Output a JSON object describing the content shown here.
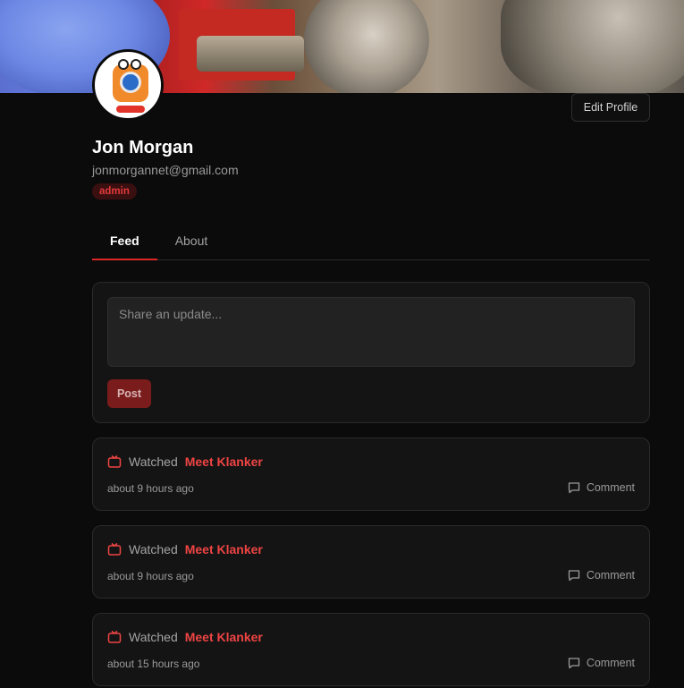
{
  "profile": {
    "name": "Jon Morgan",
    "email": "jonmorgannet@gmail.com",
    "role_badge": "admin",
    "edit_label": "Edit Profile"
  },
  "tabs": [
    {
      "label": "Feed",
      "active": true
    },
    {
      "label": "About",
      "active": false
    }
  ],
  "composer": {
    "placeholder": "Share an update...",
    "post_label": "Post"
  },
  "feed": [
    {
      "icon": "tv-icon",
      "verb": "Watched",
      "title": "Meet Klanker",
      "time": "about 9 hours ago",
      "comment_label": "Comment"
    },
    {
      "icon": "tv-icon",
      "verb": "Watched",
      "title": "Meet Klanker",
      "time": "about 9 hours ago",
      "comment_label": "Comment"
    },
    {
      "icon": "tv-icon",
      "verb": "Watched",
      "title": "Meet Klanker",
      "time": "about 15 hours ago",
      "comment_label": "Comment"
    }
  ],
  "colors": {
    "accent": "#dc2626",
    "background": "#0b0b0b",
    "card": "#141414"
  }
}
